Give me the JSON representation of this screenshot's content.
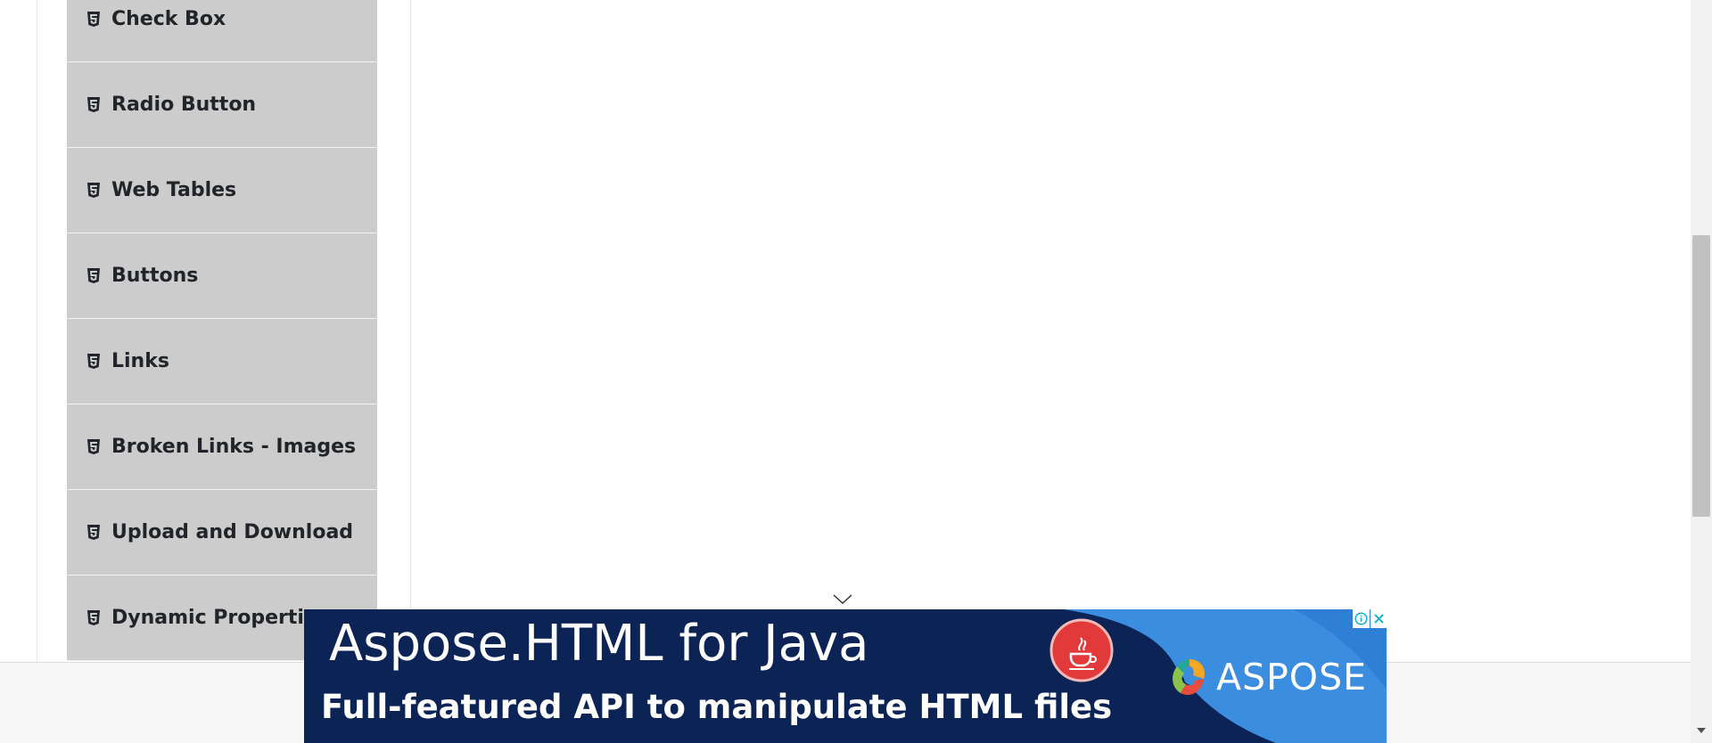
{
  "menu": {
    "items": [
      {
        "label": "Check Box",
        "icon": "html5-icon"
      },
      {
        "label": "Radio Button",
        "icon": "html5-icon"
      },
      {
        "label": "Web Tables",
        "icon": "html5-icon"
      },
      {
        "label": "Buttons",
        "icon": "html5-icon"
      },
      {
        "label": "Links",
        "icon": "html5-icon"
      },
      {
        "label": "Broken Links - Images",
        "icon": "html5-icon"
      },
      {
        "label": "Upload and Download",
        "icon": "html5-icon"
      },
      {
        "label": "Dynamic Properties",
        "icon": "html5-icon"
      }
    ]
  },
  "ad": {
    "title": "Aspose.HTML for Java",
    "subtitle": "Full-featured API to manipulate HTML files",
    "brand": "ASPOSE",
    "collapse_icon": "chevron-down-icon",
    "info_icon": "info-icon",
    "close_icon": "close-icon"
  },
  "colors": {
    "menu_bg": "#cccccc",
    "ad_navy": "#0b2355",
    "ad_blue": "#3b8de0",
    "java_red": "#e23a3a"
  }
}
